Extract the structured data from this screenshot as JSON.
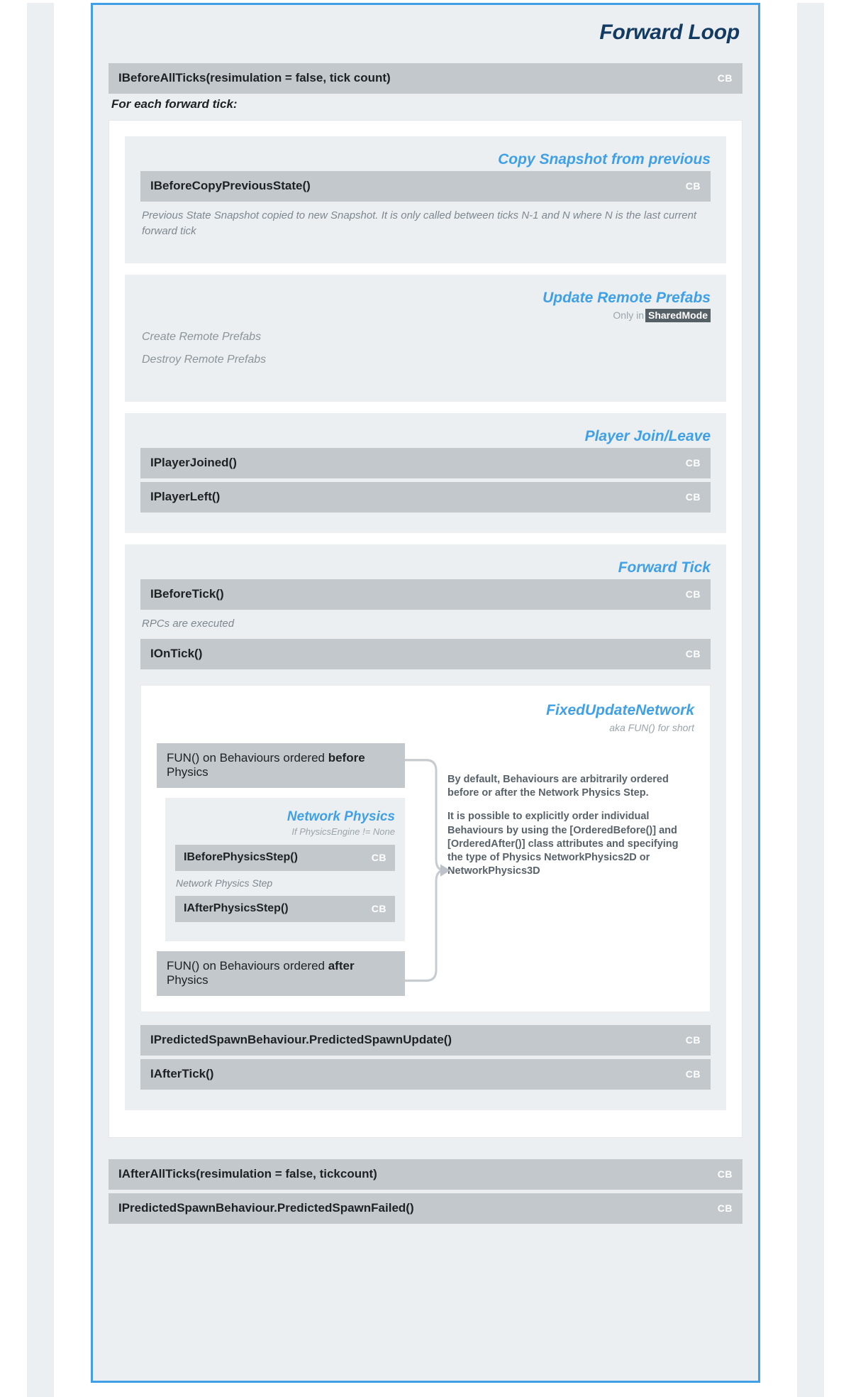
{
  "diagram": {
    "title": "Forward Loop",
    "accent_color": "#3fa0e8",
    "title_color": "#123a63",
    "bar_color": "#c3c8cc",
    "panel_color": "#eceff1",
    "callback_tag": "CB"
  },
  "top": {
    "before_all_ticks": "IBeforeAllTicks(resimulation = false, tick count)",
    "for_each_label": "For each forward tick:"
  },
  "copy_snapshot": {
    "title": "Copy Snapshot from previous",
    "callback": "IBeforeCopyPreviousState()",
    "note": "Previous State Snapshot copied to new Snapshot. It is only called between ticks N-1 and N where N is the last current forward tick"
  },
  "remote_prefabs": {
    "title": "Update Remote Prefabs",
    "sub_prefix": "Only in",
    "sub_badge": "SharedMode",
    "lines": [
      "Create Remote Prefabs",
      "Destroy Remote Prefabs"
    ]
  },
  "player_join_leave": {
    "title": "Player Join/Leave",
    "callbacks": [
      "IPlayerJoined()",
      "IPlayerLeft()"
    ]
  },
  "forward_tick": {
    "title": "Forward Tick",
    "before_tick": "IBeforeTick()",
    "rpc_note": "RPCs are executed",
    "on_tick": "IOnTick()",
    "predicted_spawn_update": "IPredictedSpawnBehaviour.PredictedSpawnUpdate()",
    "after_tick": "IAfterTick()"
  },
  "fun": {
    "title": "FixedUpdateNetwork",
    "subtitle": "aka FUN() for short",
    "before_bar_pre": "FUN() on Behaviours ordered ",
    "before_bar_strong": "before",
    "before_bar_post": " Physics",
    "after_bar_pre": "FUN() on Behaviours ordered ",
    "after_bar_strong": "after",
    "after_bar_post": " Physics",
    "annotation_1": "By default, Behaviours are arbitrarily ordered before or after the Network Physics Step.",
    "annotation_2": "It is possible to explicitly order individual Behaviours by using the [OrderedBefore()] and [OrderedAfter()] class attributes and specifying the type of Physics NetworkPhysics2D or NetworkPhysics3D"
  },
  "network_physics": {
    "title": "Network Physics",
    "subtitle": "If PhysicsEngine != None",
    "before_step": "IBeforePhysicsStep()",
    "step_note": "Network Physics Step",
    "after_step": "IAfterPhysicsStep()"
  },
  "bottom": {
    "after_all_ticks": "IAfterAllTicks(resimulation = false, tickcount)",
    "predicted_spawn_failed": "IPredictedSpawnBehaviour.PredictedSpawnFailed()"
  }
}
